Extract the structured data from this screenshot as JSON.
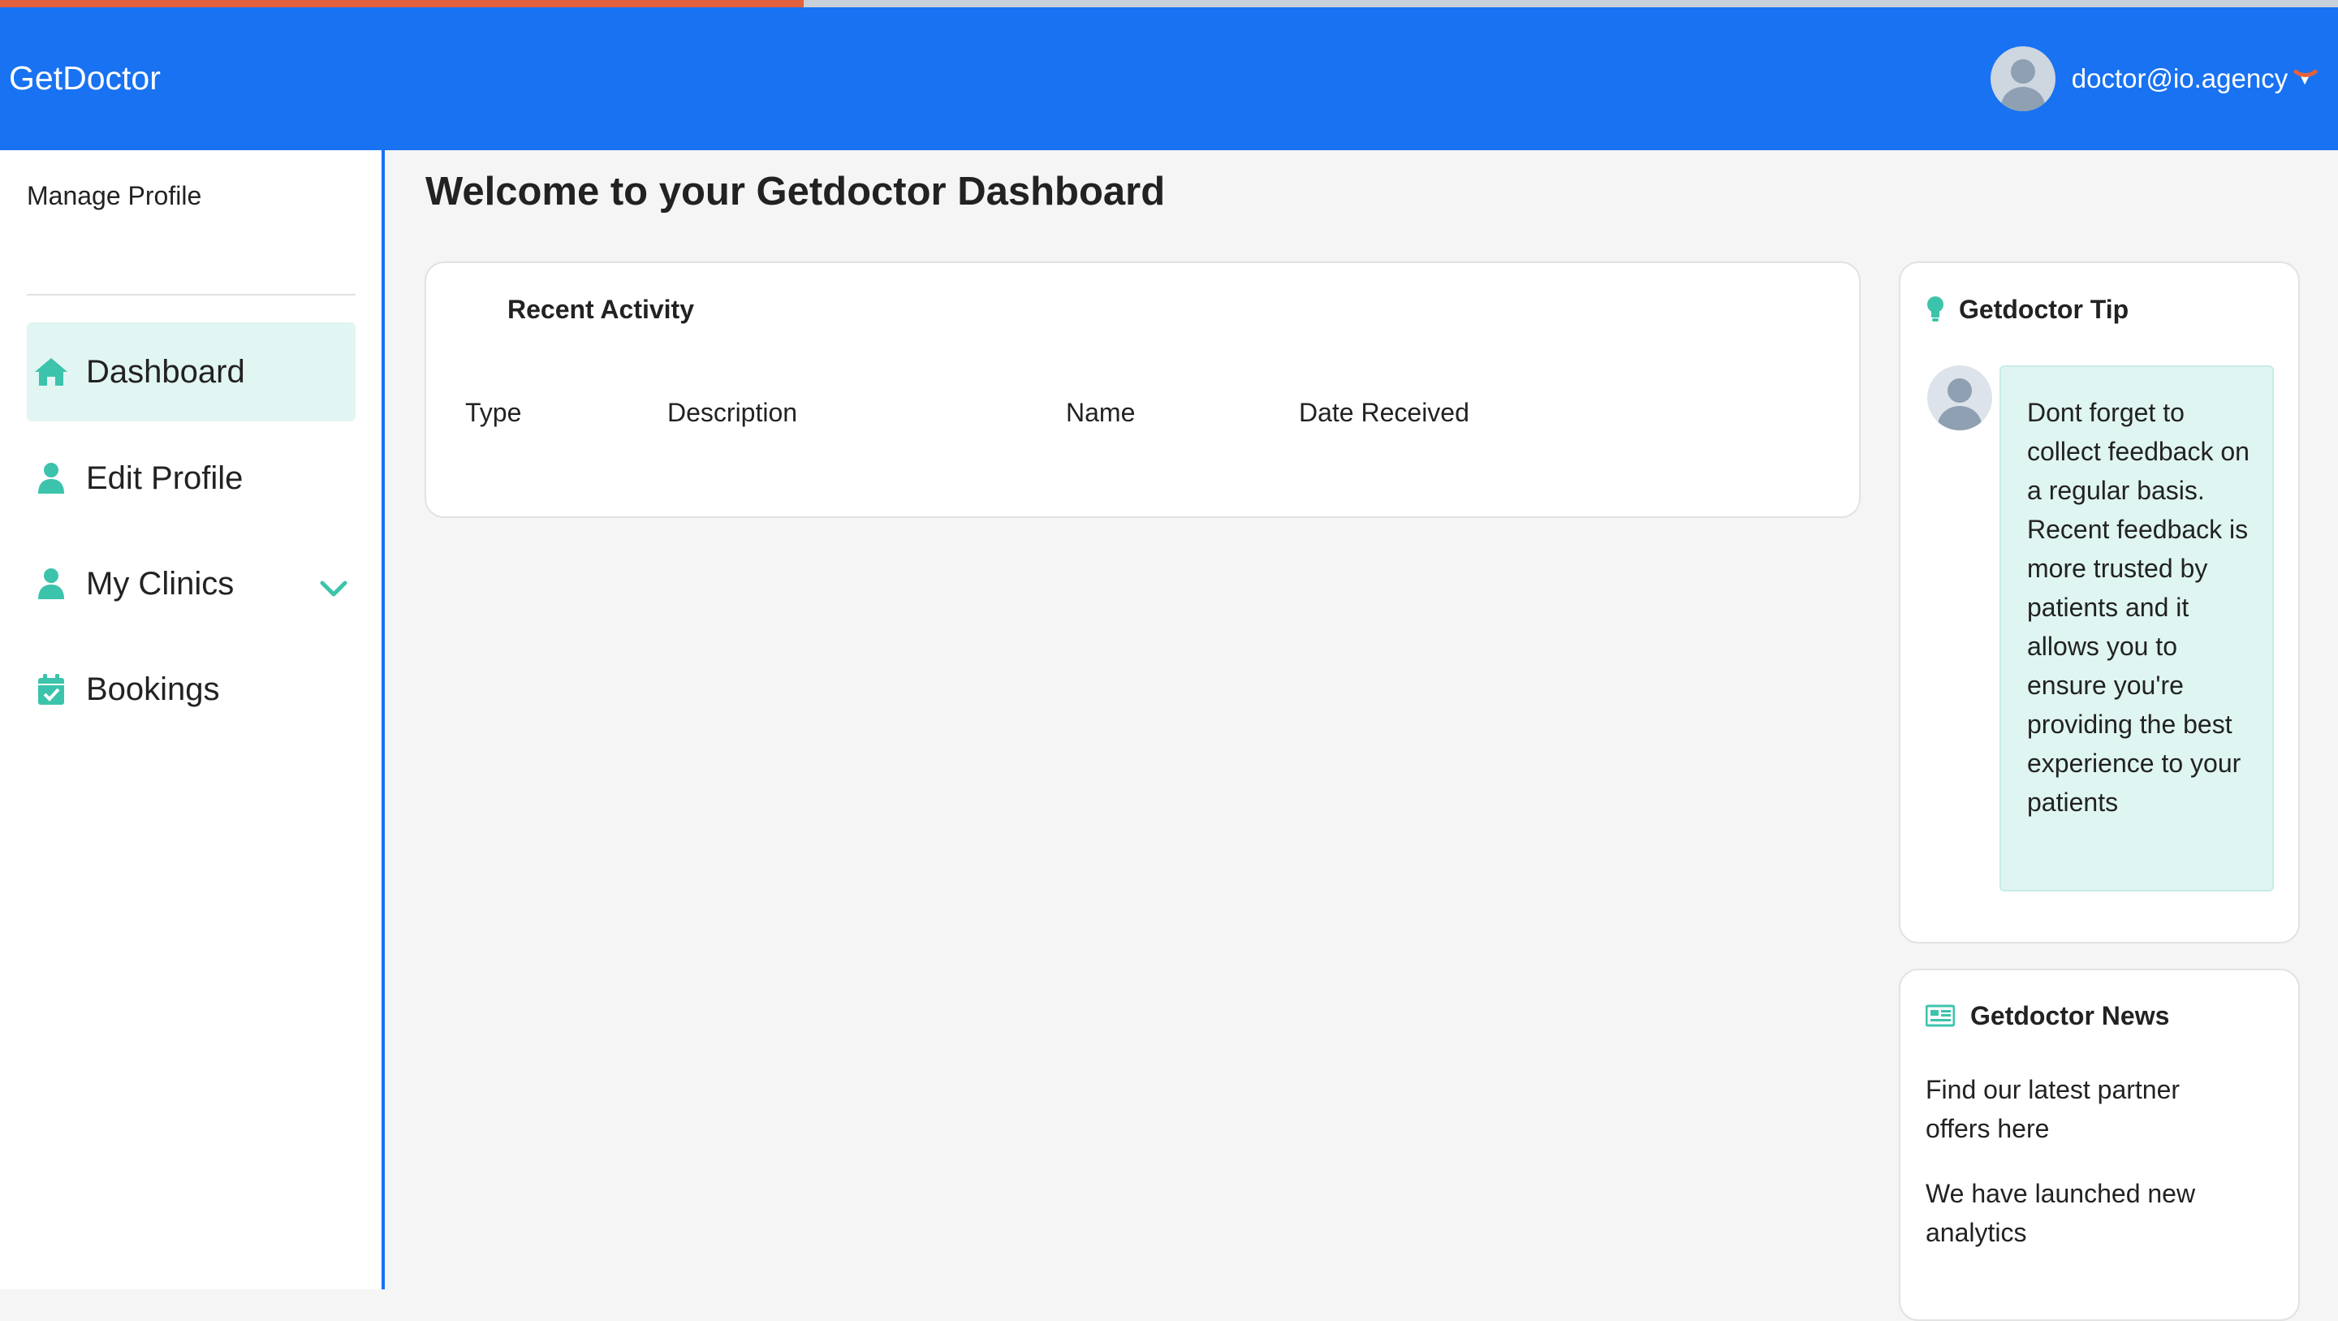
{
  "app": {
    "brand": "GetDoctor"
  },
  "user": {
    "email": "doctor@io.agency"
  },
  "sidebar": {
    "manage_label": "Manage Profile",
    "items": [
      {
        "label": "Dashboard",
        "icon": "home-icon",
        "active": true
      },
      {
        "label": "Edit Profile",
        "icon": "user-icon",
        "active": false
      },
      {
        "label": "My Clinics",
        "icon": "user-icon",
        "active": false,
        "expandable": true
      },
      {
        "label": "Bookings",
        "icon": "calendar-check-icon",
        "active": false
      }
    ]
  },
  "main": {
    "title": "Welcome to your Getdoctor Dashboard",
    "recent_activity": {
      "title": "Recent Activity",
      "columns": [
        "Type",
        "Description",
        "Name",
        "Date Received"
      ]
    },
    "tip": {
      "title": "Getdoctor Tip",
      "text": "Dont forget to collect feedback on a regular basis. Recent feedback is more trusted by patients and it allows you to ensure you're providing the best experience to your patients"
    },
    "news": {
      "title": "Getdoctor News",
      "items": [
        "Find our latest partner offers here",
        "We have launched new analytics"
      ]
    }
  },
  "colors": {
    "primary": "#1872f2",
    "accent": "#3cc3ab",
    "active_bg": "#e1f5f2",
    "progress": "#e2613f"
  }
}
